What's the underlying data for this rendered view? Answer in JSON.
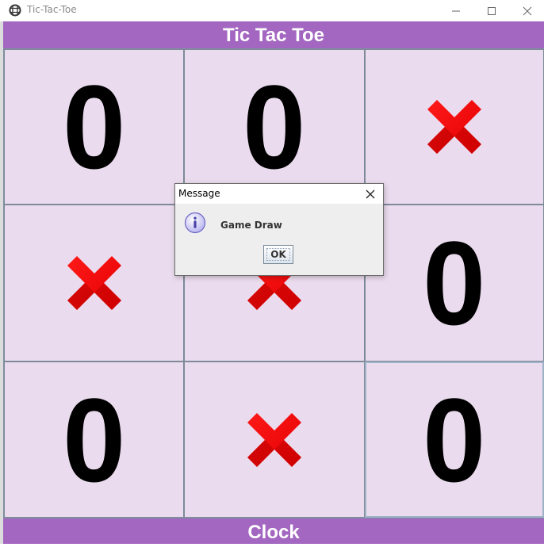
{
  "window": {
    "title": "Tic-Tac-Toe",
    "icon": "tic-tac-toe-app-icon",
    "controls": [
      "minimize",
      "maximize",
      "close"
    ]
  },
  "header": {
    "title": "Tic Tac Toe"
  },
  "footer": {
    "label": "Clock"
  },
  "board": {
    "cells": [
      {
        "mark": "0"
      },
      {
        "mark": "0"
      },
      {
        "mark": "X"
      },
      {
        "mark": "X"
      },
      {
        "mark": "X"
      },
      {
        "mark": "0"
      },
      {
        "mark": "0"
      },
      {
        "mark": "X"
      },
      {
        "mark": "0"
      }
    ],
    "focused_cell": 8
  },
  "dialog": {
    "title": "Message",
    "icon": "info-icon",
    "message": "Game Draw",
    "ok_label": "OK"
  },
  "colors": {
    "banner": "#a366c1",
    "cell_background": "#ebdbee",
    "x_mark": "#e30000",
    "o_mark": "#000000"
  }
}
